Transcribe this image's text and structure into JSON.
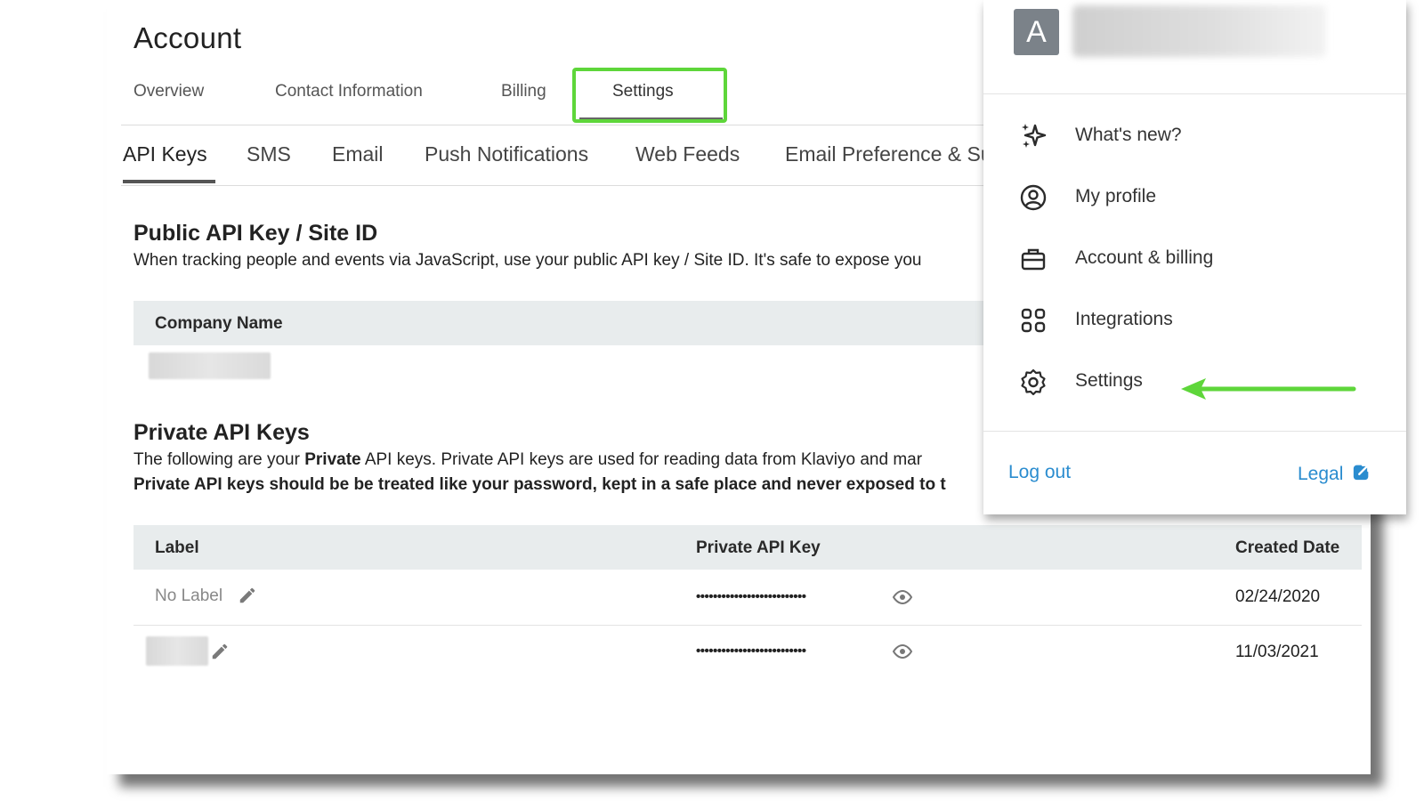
{
  "page": {
    "title": "Account",
    "top_tabs": [
      "Overview",
      "Contact Information",
      "Billing",
      "Settings"
    ],
    "active_top_tab": "Settings",
    "sub_tabs": [
      "API Keys",
      "SMS",
      "Email",
      "Push Notifications",
      "Web Feeds",
      "Email Preference & Su"
    ],
    "active_sub_tab": "API Keys"
  },
  "public_api": {
    "title": "Public API Key / Site ID",
    "description": "When tracking people and events via JavaScript, use your public API key / Site ID. It's safe to expose you",
    "column_header": "Company Name"
  },
  "private_api": {
    "title": "Private API Keys",
    "desc_line1_pre": "The following are your ",
    "desc_line1_bold": "Private",
    "desc_line1_post": " API keys. Private API keys are used for reading data from Klaviyo and mar",
    "desc_line2": "Private API keys should be be treated like your password, kept in a safe place and never exposed to t",
    "columns": {
      "label": "Label",
      "key": "Private API Key",
      "created": "Created Date"
    },
    "rows": [
      {
        "label": "No Label",
        "key_masked": "••••••••••••••••••••••••••",
        "created": "02/24/2020"
      },
      {
        "label": "",
        "key_masked": "••••••••••••••••••••••••••",
        "created": "11/03/2021"
      }
    ]
  },
  "menu": {
    "avatar_letter": "A",
    "items": [
      {
        "label": "What's new?",
        "icon": "sparkle-icon"
      },
      {
        "label": "My profile",
        "icon": "user-circle-icon"
      },
      {
        "label": "Account & billing",
        "icon": "briefcase-icon"
      },
      {
        "label": "Integrations",
        "icon": "grid-icon"
      },
      {
        "label": "Settings",
        "icon": "gear-icon"
      }
    ],
    "logout": "Log out",
    "legal": "Legal"
  },
  "colors": {
    "highlight": "#5ed63a",
    "link": "#2a8ccf",
    "table_header_bg": "#e8eced"
  }
}
